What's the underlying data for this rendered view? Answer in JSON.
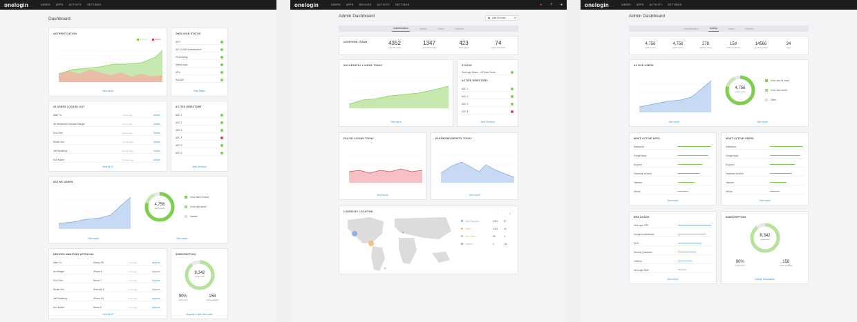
{
  "screen1": {
    "logo": "onelogin",
    "nav": [
      "USERS",
      "APPS",
      "ACTIVITY",
      "SETTINGS"
    ],
    "title": "Dashboard",
    "auth": {
      "title": "AUTHENTICATION",
      "legend_success": "Success",
      "legend_failure": "Failure",
      "view": "View report"
    },
    "status": {
      "title": "ONELOGIN STATUS",
      "items": [
        "SSO",
        "AD & LDAP Authentication",
        "Provisioning",
        "Mobile Apps",
        "APIs",
        "RADIUS"
      ],
      "view": "View Status"
    },
    "locked": {
      "title": "23 USERS LOCKED OUT",
      "rows": [
        {
          "name": "Allan Yu",
          "time": "2 hour ago",
          "action": "Unlock"
        },
        {
          "name": "Ian Smithseed Limousin-Mangel",
          "time": "2 hour ago",
          "action": "Unlock"
        },
        {
          "name": "Eva Chen",
          "time": "2 hour ago",
          "action": "Unlock"
        },
        {
          "name": "Renier Sun",
          "time": "3 hours ago",
          "action": "Unlock"
        },
        {
          "name": "Jeff Sandberg",
          "time": "8 hours ago",
          "action": "Unlock"
        },
        {
          "name": "Kurt Kobiet",
          "time": "11 days ago",
          "action": "Unlock"
        }
      ],
      "view": "View all 23"
    },
    "ad": {
      "title": "ACTIVE DIRECTORY",
      "items": [
        {
          "name": "ADC 1",
          "color": "#7fcf4e"
        },
        {
          "name": "ADC 2",
          "color": "#7fcf4e"
        },
        {
          "name": "ADC 3",
          "color": "#7fcf4e"
        },
        {
          "name": "ADC 4",
          "color": "#d9455f"
        },
        {
          "name": "ADC 5",
          "color": "#7fcf4e"
        },
        {
          "name": "ADC 6",
          "color": "#7fcf4e"
        }
      ],
      "view": "View Directory"
    },
    "active": {
      "title": "ACTIVE USERS",
      "count": "4,756",
      "sub": "active users",
      "legend": [
        "In the last 24 hours",
        "In the last month",
        "Inactive"
      ],
      "view_left": "View report",
      "view_right": "View report"
    },
    "devices": {
      "title": "DEVICES AWAITING APPROVAL",
      "rows": [
        {
          "name": "Allan Yu",
          "device": "Galaxy S8",
          "time": "2 min ago",
          "action": "Approve"
        },
        {
          "name": "Ian Mangel",
          "device": "iPhone 6",
          "time": "2 min ago",
          "action": "Approve"
        },
        {
          "name": "Eva Chen",
          "device": "Nexus 7",
          "time": "2 min ago",
          "action": "Approve"
        },
        {
          "name": "Renier Sun",
          "device": "iPad mini 3",
          "time": "4 min ago",
          "action": "Approve"
        },
        {
          "name": "Jeff Sandberg",
          "device": "iPhone 4S",
          "time": "5 min ago",
          "action": "Approve"
        },
        {
          "name": "Kurt Kobiet",
          "device": "Nexus 5",
          "time": "6 min ago",
          "action": "Approve"
        }
      ],
      "view": "View all 23"
    },
    "subscription": {
      "title": "SUBSCRIPTION",
      "count": "8,342",
      "sub": "seats used",
      "pct": "90%",
      "pct_lbl": "seats used",
      "avail": "158",
      "avail_lbl": "seats available",
      "link": "Upgrade to add more seats"
    }
  },
  "screen2": {
    "logo": "onelogin",
    "nav": [
      "USERS",
      "APPS",
      "DEVICES",
      "ACTIVITY",
      "SETTINGS"
    ],
    "title": "Admin Dashboard",
    "range": "Last 24 hours",
    "tabs": [
      "Authentication",
      "Activity",
      "Users",
      "Devices"
    ],
    "overview": {
      "title": "OVERVIEW TODAY",
      "stats": [
        {
          "num": "4352",
          "lbl": "currently active"
        },
        {
          "num": "1347",
          "lbl": "successful logins"
        },
        {
          "num": "423",
          "lbl": "failed logins"
        },
        {
          "num": "74",
          "lbl": "password resets"
        }
      ]
    },
    "success": {
      "title": "SUCCESSFUL LOGINS TODAY",
      "view": "View report"
    },
    "status": {
      "title": "STATUS",
      "item": "OneLogin Status - US Data Center",
      "ad_title": "ACTIVE DIRECTORY",
      "ad": [
        {
          "name": "ADC 1",
          "color": "#7fcf4e"
        },
        {
          "name": "ADC 2",
          "color": "#7fcf4e"
        },
        {
          "name": "ADC 3",
          "color": "#7fcf4e"
        },
        {
          "name": "ADC 4",
          "color": "#d9455f"
        }
      ],
      "view": "View Directory"
    },
    "failed": {
      "title": "FAILED LOGINS TODAY",
      "view": "View report"
    },
    "resets": {
      "title": "PASSWORD RESETS TODAY",
      "view": "View report"
    },
    "location": {
      "title": "LOGINS BY LOCATION",
      "rows": [
        {
          "city": "San Francisco",
          "color": "#7aa7d8",
          "a": "1024",
          "b": "87"
        },
        {
          "city": "Miami",
          "color": "#f2b463",
          "a": "1024",
          "b": "32"
        },
        {
          "city": "Sao Paulo",
          "color": "#a7d37e",
          "a": "95",
          "b": "4"
        },
        {
          "city": "London",
          "color": "#c98ad6",
          "a": "0",
          "b": "110"
        }
      ]
    }
  },
  "screen3": {
    "logo": "onelogin",
    "nav": [
      "USERS",
      "APPS",
      "ACTIVITY",
      "SETTINGS"
    ],
    "title": "Admin Dashboard",
    "tabs": [
      "Authentication",
      "Activity",
      "Users",
      "Devices"
    ],
    "stats": [
      {
        "num": "4,756",
        "lbl": "active users"
      },
      {
        "num": "4,756",
        "lbl": "active users"
      },
      {
        "num": "278",
        "lbl": "inactive users"
      },
      {
        "num": "158",
        "lbl": "seats remaining"
      },
      {
        "num": "14566",
        "lbl": "apps accessed"
      },
      {
        "num": "34",
        "lbl": "apps"
      }
    ],
    "active": {
      "title": "ACTIVE USERS",
      "count": "4,756",
      "sub": "active users",
      "legend": [
        "In the last 24 hours",
        "In the last month",
        "Other"
      ],
      "view_left": "View report",
      "view_right": "View report"
    },
    "apps": {
      "title": "MOST ACTIVE APPS",
      "rows": [
        "Salesforce",
        "Google Apps",
        "Dropbox",
        "Facebook at Work",
        "Yammer",
        "GitHub"
      ],
      "view": "View report"
    },
    "users": {
      "title": "MOST ACTIVE USERS",
      "rows": [
        "Salesforce",
        "Google Apps",
        "Dropbox",
        "Facebook at Work",
        "Yammer",
        "GitHub"
      ],
      "view": "View report"
    },
    "mfa": {
      "title": "MFA USAGE",
      "rows": [
        "OneLogin OTP",
        "Google Authenticator",
        "DUO",
        "Security Questions",
        "YubiKey",
        "OneLogin SMS"
      ],
      "view": "View report"
    },
    "subscription": {
      "title": "SUBSCRIPTION",
      "count": "8,342",
      "sub": "seats used",
      "pct": "90%",
      "pct_lbl": "seats used",
      "avail": "158",
      "avail_lbl": "seats available",
      "link": "Change Subscription"
    }
  }
}
